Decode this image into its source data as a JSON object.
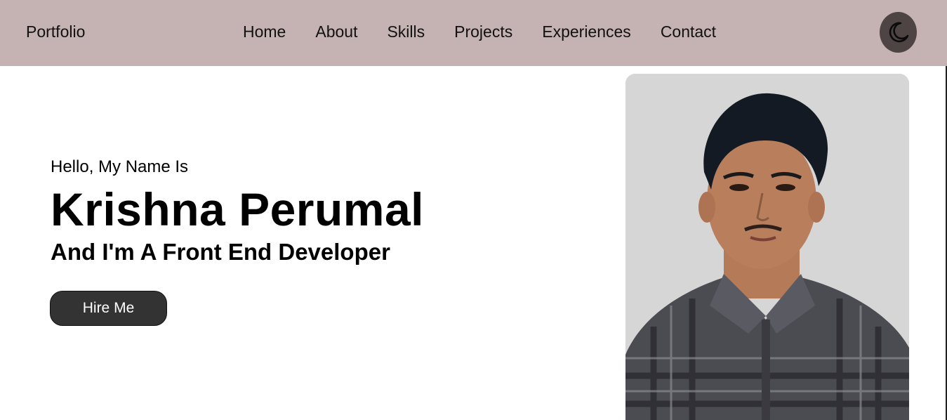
{
  "header": {
    "brand": "Portfolio",
    "nav": [
      "Home",
      "About",
      "Skills",
      "Projects",
      "Experiences",
      "Contact"
    ],
    "theme_toggle_icon": "moon-icon"
  },
  "hero": {
    "greeting": "Hello, My Name Is",
    "name": "Krishna Perumal",
    "role": "And I'm A Front End Developer",
    "cta_label": "Hire Me",
    "photo_icon": "profile-photo"
  },
  "colors": {
    "header_bg": "#c4b3b2",
    "toggle_bg": "#4d4443",
    "button_bg": "#333333"
  }
}
